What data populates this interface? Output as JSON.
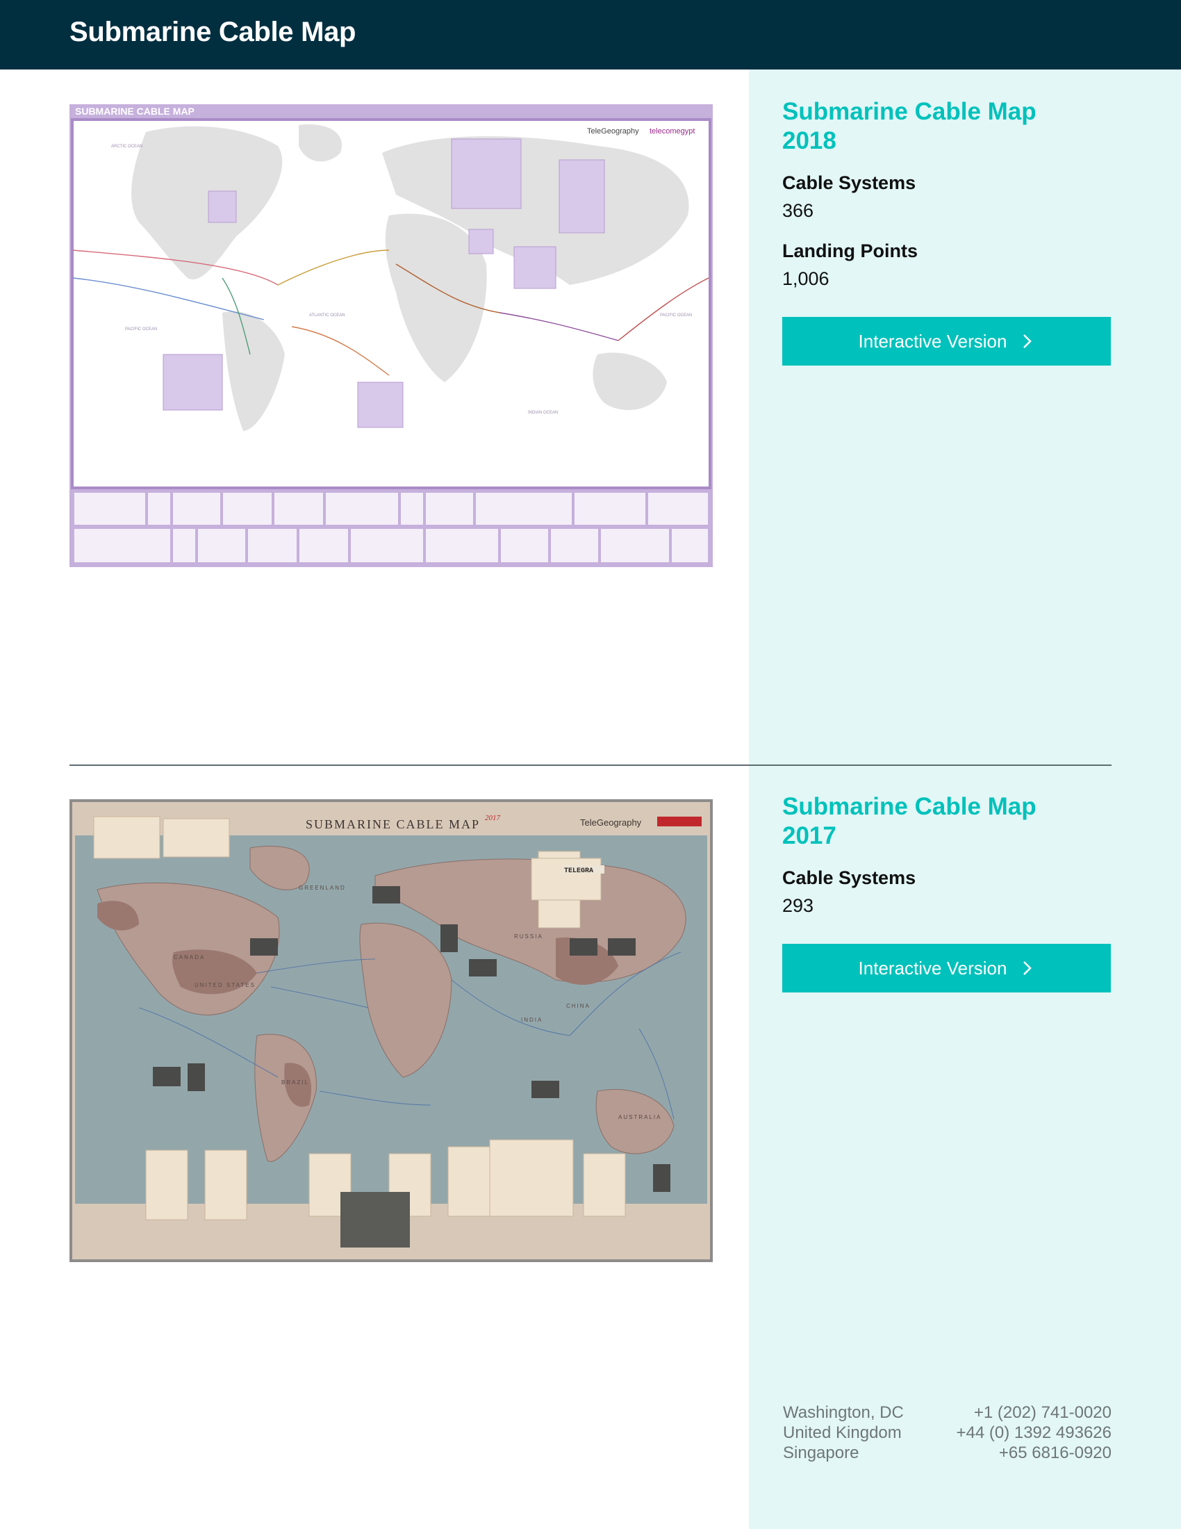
{
  "header": {
    "title": "Submarine Cable Map"
  },
  "maps": [
    {
      "title": "Submarine Cable Map 2018",
      "stats": [
        {
          "label": "Cable Systems",
          "value": "366"
        },
        {
          "label": "Landing Points",
          "value": "1,006"
        }
      ],
      "cta_label": "Interactive Version",
      "image": {
        "banner": "SUBMARINE CABLE MAP",
        "brand_left": "TeleGeography",
        "brand_right": "telecomegypt",
        "ocean_labels": [
          "ARCTIC OCEAN",
          "ATLANTIC OCEAN",
          "PACIFIC OCEAN",
          "PACIFIC OCEAN",
          "INDIAN OCEAN"
        ],
        "colors": {
          "frame": "#b79bcf",
          "land": "#e3e3e3",
          "inset": "#cdb8e0"
        }
      }
    },
    {
      "title": "Submarine Cable Map 2017",
      "stats": [
        {
          "label": "Cable Systems",
          "value": "293"
        }
      ],
      "cta_label": "Interactive Version",
      "image": {
        "banner": "SUBMARINE CABLE MAP",
        "year_tag": "2017",
        "brand_left": "TeleGeography",
        "region_labels": [
          "CANADA",
          "UNITED STATES",
          "BRAZIL",
          "RUSSIA",
          "CHINA",
          "INDIA",
          "AUSTRALIA",
          "GREENLAND"
        ],
        "stamp": "TELEGRA",
        "colors": {
          "frame": "#d9cbbd",
          "ocean": "#8fa3a8",
          "land": "#a8867f"
        }
      }
    }
  ],
  "footer": {
    "offices": [
      {
        "city": "Washington, DC",
        "phone": "+1 (202) 741-0020"
      },
      {
        "city": "United Kingdom",
        "phone": "+44 (0) 1392 493626"
      },
      {
        "city": "Singapore",
        "phone": "+65 6816-0920"
      }
    ]
  },
  "theme": {
    "header_bg": "#012f40",
    "accent": "#00c1bb",
    "panel_bg": "#e2f7f6"
  }
}
